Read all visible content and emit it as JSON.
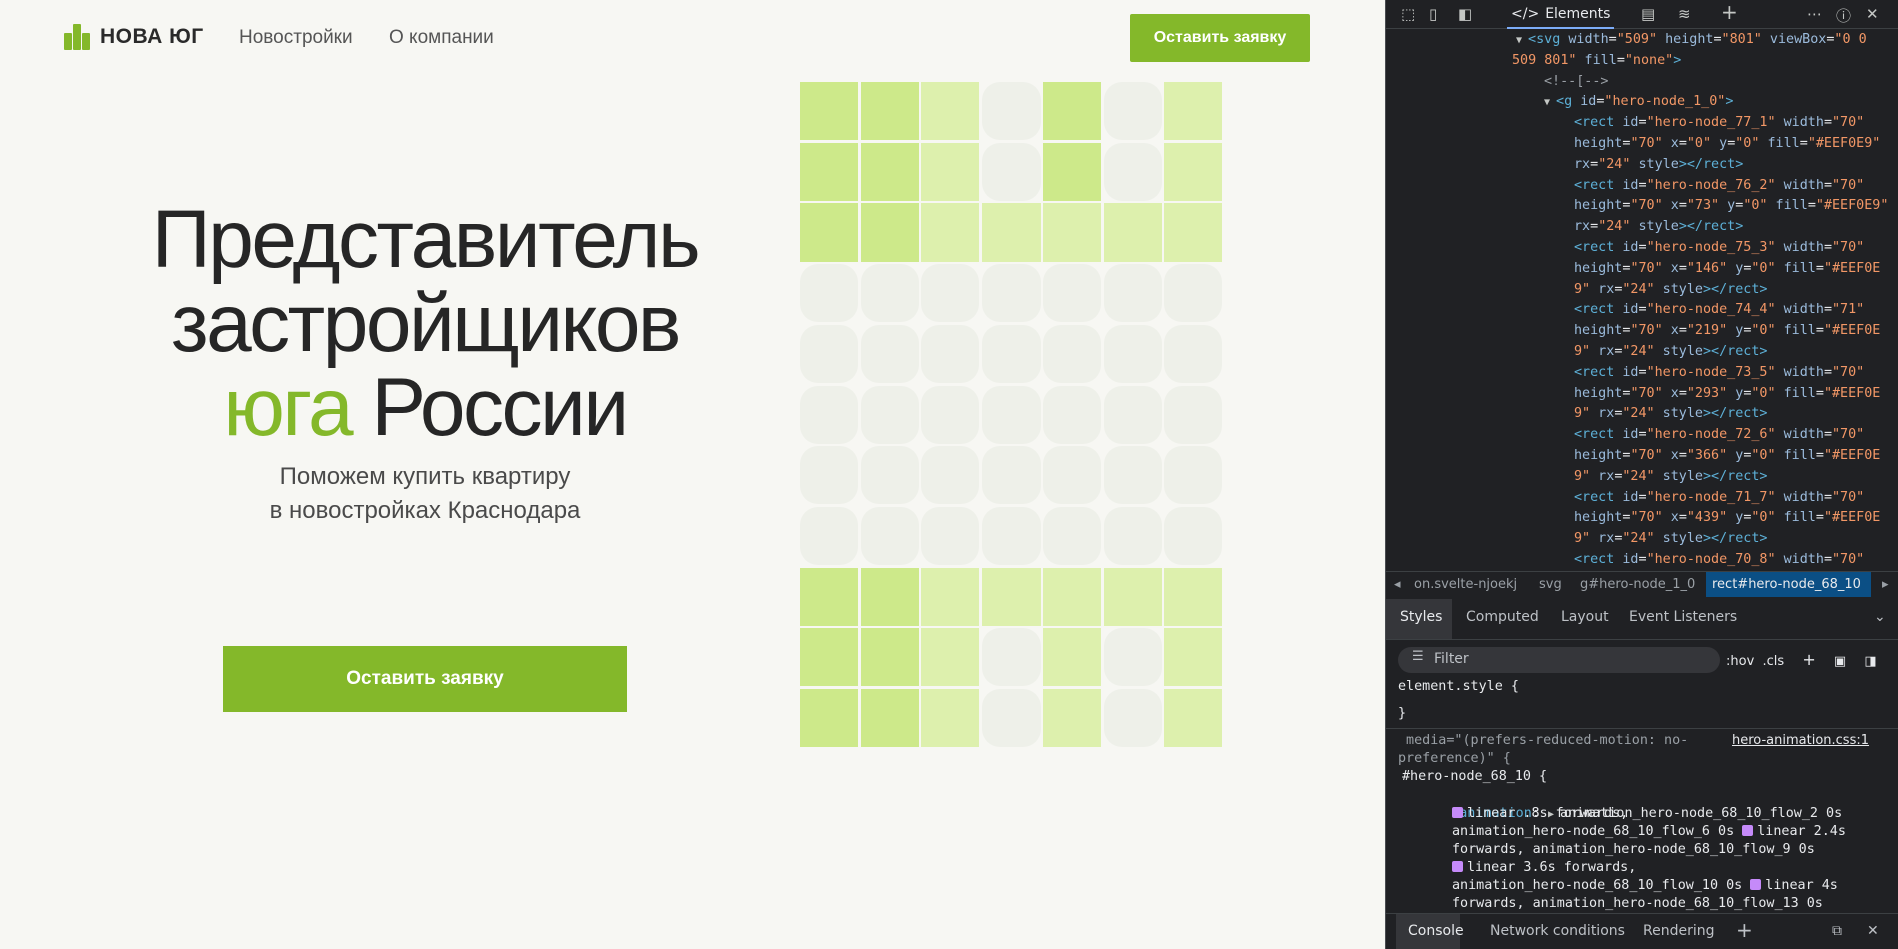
{
  "site": {
    "brand": "НОВА ЮГ",
    "nav": [
      "Новостройки",
      "О компании"
    ],
    "header_cta": "Оставить заявку",
    "hero": {
      "line1": "Представитель",
      "line2": "застройщиков",
      "line3_accent": "юга",
      "line3_rest": " России",
      "subtitle_line1": "Поможем купить квартиру",
      "subtitle_line2": "в новостройках Краснодара",
      "cta": "Оставить заявку"
    },
    "grid_pattern": [
      "DDLFDFL",
      "DDLFDFL",
      "DDLLLLL",
      "FFFFFFF",
      "FFFFFFF",
      "FFFFFFF",
      "FFFFFFF",
      "FFFFFFF",
      "DDLLLLL",
      "DDLFLFL",
      "DDLFLFL"
    ],
    "grid_colors": {
      "D": "#cde98a",
      "L": "#ddf0ad",
      "F": "#eef0e9"
    }
  },
  "devtools": {
    "tabs": {
      "elements": "Elements"
    },
    "dom_lines": [
      {
        "parts": [
          [
            "tri",
            "▼ "
          ],
          [
            "tag",
            "<svg "
          ],
          [
            "attr",
            "width"
          ],
          [
            "txt",
            "="
          ],
          [
            "val",
            "\"509\""
          ],
          [
            "attr",
            " height"
          ],
          [
            "txt",
            "="
          ],
          [
            "val",
            "\"801\""
          ],
          [
            "attr",
            " viewBox"
          ],
          [
            "txt",
            "="
          ],
          [
            "val",
            "\"0 0"
          ]
        ]
      },
      {
        "parts": [
          [
            "val",
            "509 801\""
          ],
          [
            "attr",
            " fill"
          ],
          [
            "txt",
            "="
          ],
          [
            "val",
            "\"none\""
          ],
          [
            "tag",
            ">"
          ]
        ]
      },
      {
        "parts": [
          [
            "cmt",
            "<!--[-->"
          ]
        ]
      },
      {
        "parts": [
          [
            "tri",
            "▼ "
          ],
          [
            "tag",
            "<g "
          ],
          [
            "attr",
            "id"
          ],
          [
            "txt",
            "="
          ],
          [
            "val",
            "\"hero-node_1_0\""
          ],
          [
            "tag",
            ">"
          ]
        ]
      },
      {
        "parts": [
          [
            "tag",
            "<rect "
          ],
          [
            "attr",
            "id"
          ],
          [
            "txt",
            "="
          ],
          [
            "val",
            "\"hero-node_77_1\""
          ],
          [
            "attr",
            " width"
          ],
          [
            "txt",
            "="
          ],
          [
            "val",
            "\"70\""
          ]
        ]
      },
      {
        "parts": [
          [
            "attr",
            "height"
          ],
          [
            "txt",
            "="
          ],
          [
            "val",
            "\"70\""
          ],
          [
            "attr",
            " x"
          ],
          [
            "txt",
            "="
          ],
          [
            "val",
            "\"0\""
          ],
          [
            "attr",
            " y"
          ],
          [
            "txt",
            "="
          ],
          [
            "val",
            "\"0\""
          ],
          [
            "attr",
            " fill"
          ],
          [
            "txt",
            "="
          ],
          [
            "val",
            "\"#EEF0E9\""
          ]
        ]
      },
      {
        "parts": [
          [
            "attr",
            "rx"
          ],
          [
            "txt",
            "="
          ],
          [
            "val",
            "\"24\""
          ],
          [
            "attr",
            " style"
          ],
          [
            "tag",
            "></rect>"
          ]
        ]
      },
      {
        "parts": [
          [
            "tag",
            "<rect "
          ],
          [
            "attr",
            "id"
          ],
          [
            "txt",
            "="
          ],
          [
            "val",
            "\"hero-node_76_2\""
          ],
          [
            "attr",
            " width"
          ],
          [
            "txt",
            "="
          ],
          [
            "val",
            "\"70\""
          ]
        ]
      },
      {
        "parts": [
          [
            "attr",
            "height"
          ],
          [
            "txt",
            "="
          ],
          [
            "val",
            "\"70\""
          ],
          [
            "attr",
            " x"
          ],
          [
            "txt",
            "="
          ],
          [
            "val",
            "\"73\""
          ],
          [
            "attr",
            " y"
          ],
          [
            "txt",
            "="
          ],
          [
            "val",
            "\"0\""
          ],
          [
            "attr",
            " fill"
          ],
          [
            "txt",
            "="
          ],
          [
            "val",
            "\"#EEF0E9\""
          ]
        ]
      },
      {
        "parts": [
          [
            "attr",
            "rx"
          ],
          [
            "txt",
            "="
          ],
          [
            "val",
            "\"24\""
          ],
          [
            "attr",
            " style"
          ],
          [
            "tag",
            "></rect>"
          ]
        ]
      },
      {
        "parts": [
          [
            "tag",
            "<rect "
          ],
          [
            "attr",
            "id"
          ],
          [
            "txt",
            "="
          ],
          [
            "val",
            "\"hero-node_75_3\""
          ],
          [
            "attr",
            " width"
          ],
          [
            "txt",
            "="
          ],
          [
            "val",
            "\"70\""
          ]
        ]
      },
      {
        "parts": [
          [
            "attr",
            "height"
          ],
          [
            "txt",
            "="
          ],
          [
            "val",
            "\"70\""
          ],
          [
            "attr",
            " x"
          ],
          [
            "txt",
            "="
          ],
          [
            "val",
            "\"146\""
          ],
          [
            "attr",
            " y"
          ],
          [
            "txt",
            "="
          ],
          [
            "val",
            "\"0\""
          ],
          [
            "attr",
            " fill"
          ],
          [
            "txt",
            "="
          ],
          [
            "val",
            "\"#EEF0E"
          ]
        ]
      },
      {
        "parts": [
          [
            "val",
            "9\""
          ],
          [
            "attr",
            " rx"
          ],
          [
            "txt",
            "="
          ],
          [
            "val",
            "\"24\""
          ],
          [
            "attr",
            " style"
          ],
          [
            "tag",
            "></rect>"
          ]
        ]
      },
      {
        "parts": [
          [
            "tag",
            "<rect "
          ],
          [
            "attr",
            "id"
          ],
          [
            "txt",
            "="
          ],
          [
            "val",
            "\"hero-node_74_4\""
          ],
          [
            "attr",
            " width"
          ],
          [
            "txt",
            "="
          ],
          [
            "val",
            "\"71\""
          ]
        ]
      },
      {
        "parts": [
          [
            "attr",
            "height"
          ],
          [
            "txt",
            "="
          ],
          [
            "val",
            "\"70\""
          ],
          [
            "attr",
            " x"
          ],
          [
            "txt",
            "="
          ],
          [
            "val",
            "\"219\""
          ],
          [
            "attr",
            " y"
          ],
          [
            "txt",
            "="
          ],
          [
            "val",
            "\"0\""
          ],
          [
            "attr",
            " fill"
          ],
          [
            "txt",
            "="
          ],
          [
            "val",
            "\"#EEF0E"
          ]
        ]
      },
      {
        "parts": [
          [
            "val",
            "9\""
          ],
          [
            "attr",
            " rx"
          ],
          [
            "txt",
            "="
          ],
          [
            "val",
            "\"24\""
          ],
          [
            "attr",
            " style"
          ],
          [
            "tag",
            "></rect>"
          ]
        ]
      },
      {
        "parts": [
          [
            "tag",
            "<rect "
          ],
          [
            "attr",
            "id"
          ],
          [
            "txt",
            "="
          ],
          [
            "val",
            "\"hero-node_73_5\""
          ],
          [
            "attr",
            " width"
          ],
          [
            "txt",
            "="
          ],
          [
            "val",
            "\"70\""
          ]
        ]
      },
      {
        "parts": [
          [
            "attr",
            "height"
          ],
          [
            "txt",
            "="
          ],
          [
            "val",
            "\"70\""
          ],
          [
            "attr",
            " x"
          ],
          [
            "txt",
            "="
          ],
          [
            "val",
            "\"293\""
          ],
          [
            "attr",
            " y"
          ],
          [
            "txt",
            "="
          ],
          [
            "val",
            "\"0\""
          ],
          [
            "attr",
            " fill"
          ],
          [
            "txt",
            "="
          ],
          [
            "val",
            "\"#EEF0E"
          ]
        ]
      },
      {
        "parts": [
          [
            "val",
            "9\""
          ],
          [
            "attr",
            " rx"
          ],
          [
            "txt",
            "="
          ],
          [
            "val",
            "\"24\""
          ],
          [
            "attr",
            " style"
          ],
          [
            "tag",
            "></rect>"
          ]
        ]
      },
      {
        "parts": [
          [
            "tag",
            "<rect "
          ],
          [
            "attr",
            "id"
          ],
          [
            "txt",
            "="
          ],
          [
            "val",
            "\"hero-node_72_6\""
          ],
          [
            "attr",
            " width"
          ],
          [
            "txt",
            "="
          ],
          [
            "val",
            "\"70\""
          ]
        ]
      },
      {
        "parts": [
          [
            "attr",
            "height"
          ],
          [
            "txt",
            "="
          ],
          [
            "val",
            "\"70\""
          ],
          [
            "attr",
            " x"
          ],
          [
            "txt",
            "="
          ],
          [
            "val",
            "\"366\""
          ],
          [
            "attr",
            " y"
          ],
          [
            "txt",
            "="
          ],
          [
            "val",
            "\"0\""
          ],
          [
            "attr",
            " fill"
          ],
          [
            "txt",
            "="
          ],
          [
            "val",
            "\"#EEF0E"
          ]
        ]
      },
      {
        "parts": [
          [
            "val",
            "9\""
          ],
          [
            "attr",
            " rx"
          ],
          [
            "txt",
            "="
          ],
          [
            "val",
            "\"24\""
          ],
          [
            "attr",
            " style"
          ],
          [
            "tag",
            "></rect>"
          ]
        ]
      },
      {
        "parts": [
          [
            "tag",
            "<rect "
          ],
          [
            "attr",
            "id"
          ],
          [
            "txt",
            "="
          ],
          [
            "val",
            "\"hero-node_71_7\""
          ],
          [
            "attr",
            " width"
          ],
          [
            "txt",
            "="
          ],
          [
            "val",
            "\"70\""
          ]
        ]
      },
      {
        "parts": [
          [
            "attr",
            "height"
          ],
          [
            "txt",
            "="
          ],
          [
            "val",
            "\"70\""
          ],
          [
            "attr",
            " x"
          ],
          [
            "txt",
            "="
          ],
          [
            "val",
            "\"439\""
          ],
          [
            "attr",
            " y"
          ],
          [
            "txt",
            "="
          ],
          [
            "val",
            "\"0\""
          ],
          [
            "attr",
            " fill"
          ],
          [
            "txt",
            "="
          ],
          [
            "val",
            "\"#EEF0E"
          ]
        ]
      },
      {
        "parts": [
          [
            "val",
            "9\""
          ],
          [
            "attr",
            " rx"
          ],
          [
            "txt",
            "="
          ],
          [
            "val",
            "\"24\""
          ],
          [
            "attr",
            " style"
          ],
          [
            "tag",
            "></rect>"
          ]
        ]
      },
      {
        "parts": [
          [
            "tag",
            "<rect "
          ],
          [
            "attr",
            "id"
          ],
          [
            "txt",
            "="
          ],
          [
            "val",
            "\"hero-node_70_8\""
          ],
          [
            "attr",
            " width"
          ],
          [
            "txt",
            "="
          ],
          [
            "val",
            "\"70\""
          ]
        ]
      }
    ],
    "breadcrumbs": [
      "on.svelte-njoekj",
      "svg",
      "g#hero-node_1_0"
    ],
    "breadcrumb_active": "rect#hero-node_68_10",
    "style_tabs": [
      "Styles",
      "Computed",
      "Layout",
      "Event Listeners"
    ],
    "filter_placeholder": "Filter",
    "filter_tools": ":hov  .cls",
    "element_style": "element.style {",
    "close_brace": "}",
    "media_query_1": " media=\"(prefers-reduced-motion: no-",
    "media_query_2": "preference)\" {",
    "source_link": "hero-animation.css:1",
    "selector": "#hero-node_68_10 {",
    "prop_name": "animation",
    "anim_lines": [
      "animation_hero-node_68_10_flow_2 0s",
      "linear .8s forwards,",
      "animation_hero-node_68_10_flow_6 0s",
      "linear 2.4s",
      "forwards, animation_hero-node_68_10_flow_9 0s",
      "linear 3.6s forwards,",
      "animation_hero-node_68_10_flow_10 0s",
      "linear 4s",
      "forwards, animation_hero-node_68_10_flow_13 0s"
    ],
    "drawer_tabs": [
      "Console",
      "Network conditions",
      "Rendering"
    ]
  }
}
